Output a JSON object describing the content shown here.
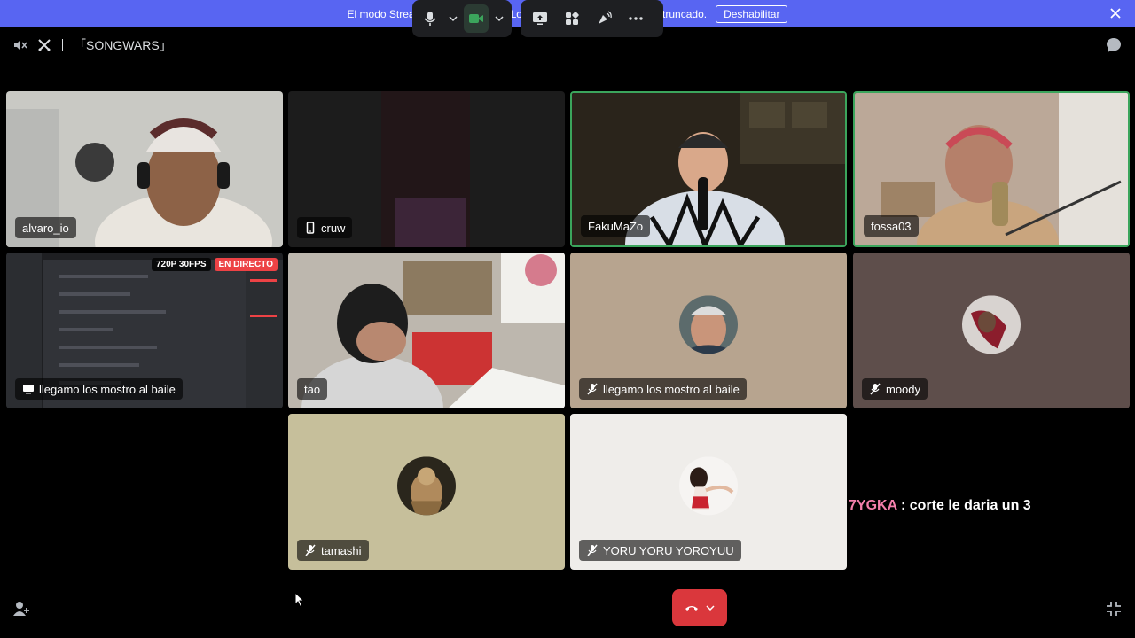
{
  "banner": {
    "message": "El modo Streamer está habilitado. Los nombres de usuario se han truncado.",
    "button_label": "Deshabilitar"
  },
  "header": {
    "channel_name": "「SONGWARS」"
  },
  "tiles": [
    {
      "name": "alvaro_io",
      "icon": "none",
      "speaking": false,
      "bg": "#c9c9c4"
    },
    {
      "name": "cruw",
      "icon": "mobile-icon",
      "speaking": false,
      "bg": "#1c1c1c"
    },
    {
      "name": "FakuMaZo",
      "icon": "none",
      "speaking": true,
      "bg": "#2a241b"
    },
    {
      "name": "fossa03",
      "icon": "none",
      "speaking": true,
      "bg": "#bba898"
    },
    {
      "name": "llegamo los mostro al baile",
      "icon": "screen-share-icon",
      "speaking": false,
      "bg": "#1e1f22"
    },
    {
      "name": "tao",
      "icon": "none",
      "speaking": false,
      "bg": "#bdb7ae"
    },
    {
      "name": "llegamo los mostro al baile",
      "icon": "mic-muted-icon",
      "speaking": false,
      "bg": "#b7a48f"
    },
    {
      "name": "moody",
      "icon": "mic-muted-icon",
      "speaking": false,
      "bg": "#5e4e4b"
    },
    {
      "name": "tamashi",
      "icon": "mic-muted-icon",
      "speaking": false,
      "bg": "#c6bf9b"
    },
    {
      "name": "YORU YORU YOROYUU",
      "icon": "mic-muted-icon",
      "speaking": false,
      "bg": "#efedea"
    }
  ],
  "stream_badges": {
    "resolution": "720P 30FPS",
    "live": "EN DIRECTO"
  },
  "overlay": {
    "user": "7YGKA",
    "text": " : corte le daria un 3"
  },
  "colors": {
    "banner": "#5865f2",
    "speaking_border": "#3ba55c",
    "hangup": "#da373c",
    "live_badge": "#ed4245",
    "control_bg": "#1e1f22"
  }
}
